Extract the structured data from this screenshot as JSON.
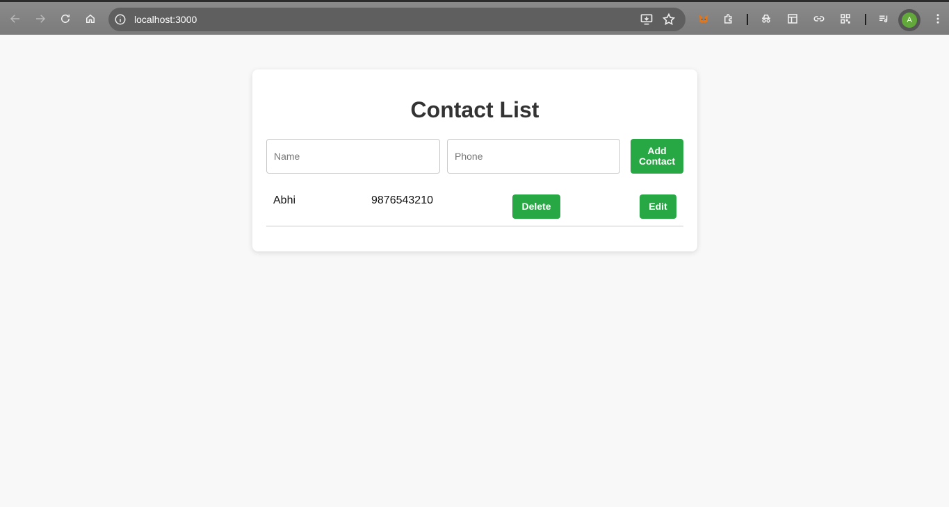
{
  "browser": {
    "url": "localhost:3000",
    "profile_initial": "A",
    "icons": [
      "back-icon",
      "forward-icon",
      "reload-icon",
      "home-icon",
      "site-info-icon",
      "install-app-icon",
      "bookmark-star-icon",
      "metamask-extension-icon",
      "extensions-puzzle-icon",
      "incognito-extension-icon",
      "layout-extension-icon",
      "link-extension-icon",
      "qr-extension-icon",
      "media-controls-icon",
      "menu-kebab-icon"
    ]
  },
  "app": {
    "title": "Contact List",
    "form": {
      "name_placeholder": "Name",
      "phone_placeholder": "Phone",
      "add_button_label": "Add Contact"
    },
    "contacts": [
      {
        "name": "Abhi",
        "phone": "9876543210",
        "delete_label": "Delete",
        "edit_label": "Edit"
      }
    ],
    "colors": {
      "accent": "#28a745",
      "background": "#f8f8f8",
      "card": "#ffffff",
      "title": "#333333"
    }
  }
}
